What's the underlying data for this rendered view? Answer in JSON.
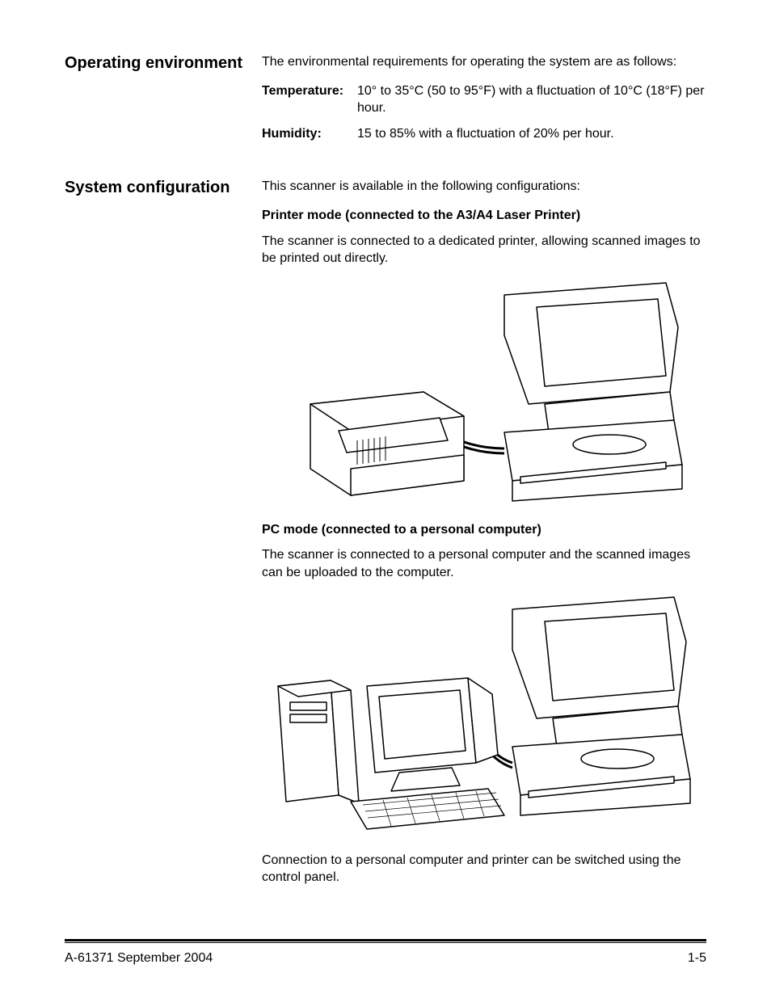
{
  "sections": {
    "operating_env": {
      "heading": "Operating environment",
      "intro": "The environmental requirements for operating the system are as follows:",
      "temperature_label": "Temperature:",
      "temperature_value": "10° to 35°C (50 to 95°F) with a fluctuation of 10°C (18°F) per hour.",
      "humidity_label": "Humidity:",
      "humidity_value": "15 to 85% with a fluctuation of 20% per hour."
    },
    "sys_config": {
      "heading": "System configuration",
      "intro": "This scanner is available in the following configurations:",
      "printer_mode_heading": "Printer mode (connected to the A3/A4 Laser Printer)",
      "printer_mode_text": "The scanner is connected to a dedicated printer, allowing scanned images to be printed out directly.",
      "pc_mode_heading": "PC mode (connected to a personal computer)",
      "pc_mode_text": "The scanner is connected to a personal computer and the scanned images can be uploaded to the computer.",
      "closing_text": "Connection to a personal computer and printer can be switched using the control panel."
    }
  },
  "footer": {
    "left": "A-61371   September 2004",
    "right": "1-5"
  }
}
